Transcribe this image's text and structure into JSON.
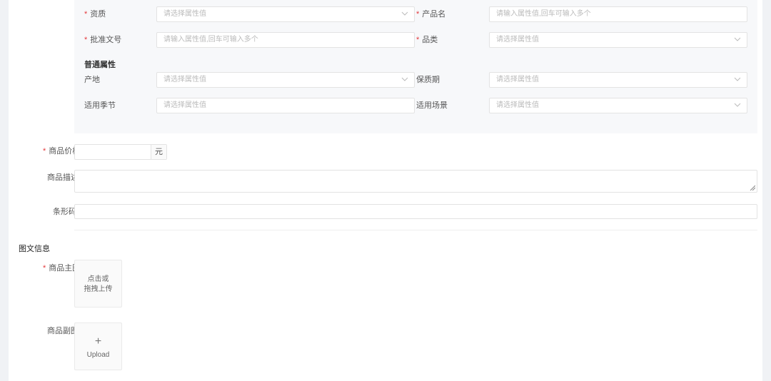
{
  "attributes": {
    "brand": {
      "label": "资质",
      "placeholder": "请选择属性值"
    },
    "product_name": {
      "label": "产品名",
      "placeholder": "请输入属性值,回车可输入多个"
    },
    "approval_no": {
      "label": "批准文号",
      "placeholder": "请输入属性值,回车可输入多个"
    },
    "category": {
      "label": "品类",
      "placeholder": "请选择属性值"
    },
    "common_title": "普通属性",
    "origin": {
      "label": "产地",
      "placeholder": "请选择属性值"
    },
    "shelf_life": {
      "label": "保质期",
      "placeholder": "请选择属性值"
    },
    "season": {
      "label": "适用季节",
      "placeholder": "请选择属性值"
    },
    "scene": {
      "label": "适用场景",
      "placeholder": "请选择属性值"
    }
  },
  "price": {
    "label": "商品价格",
    "value": "",
    "unit": "元"
  },
  "description": {
    "label": "商品描述",
    "value": ""
  },
  "barcode": {
    "label": "条形码",
    "value": ""
  },
  "media": {
    "title": "图文信息",
    "main_image": {
      "label": "商品主图",
      "line1": "点击或",
      "line2": "拖拽上传"
    },
    "sub_image": {
      "label": "商品副图",
      "plus": "+",
      "upload": "Upload"
    }
  }
}
